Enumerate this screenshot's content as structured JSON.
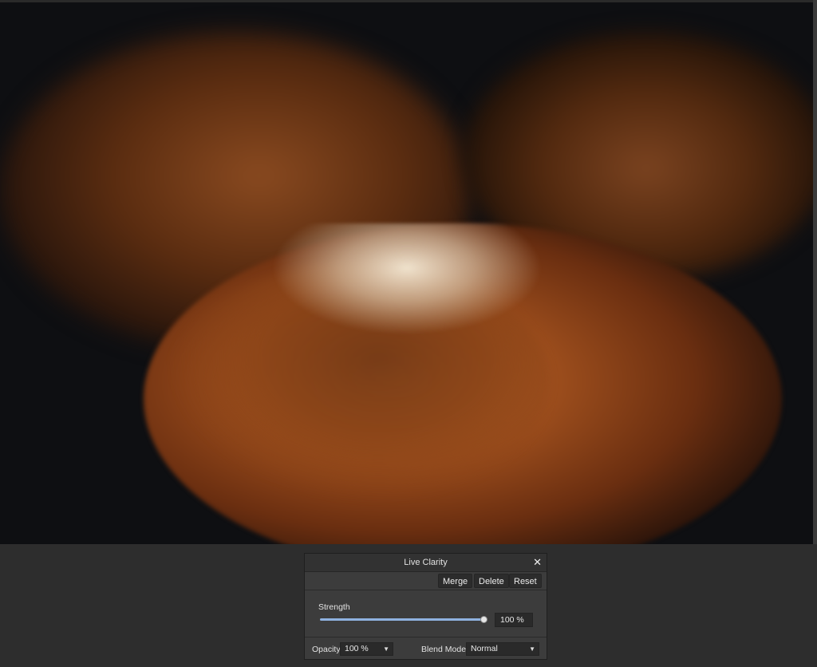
{
  "dialog": {
    "title": "Live Clarity",
    "close_icon": "close-icon",
    "buttons": {
      "merge": "Merge",
      "delete": "Delete",
      "reset": "Reset"
    },
    "strength": {
      "label": "Strength",
      "value_text": "100 %",
      "value_fraction": 1.0
    },
    "opacity": {
      "label": "Opacity:",
      "value": "100 %"
    },
    "blend_mode": {
      "label": "Blend Mode:",
      "value": "Normal"
    }
  },
  "colors": {
    "slider_accent": "#8fb2e0",
    "panel_bg": "#3c3c3c",
    "app_bg": "#2d2d2d"
  }
}
